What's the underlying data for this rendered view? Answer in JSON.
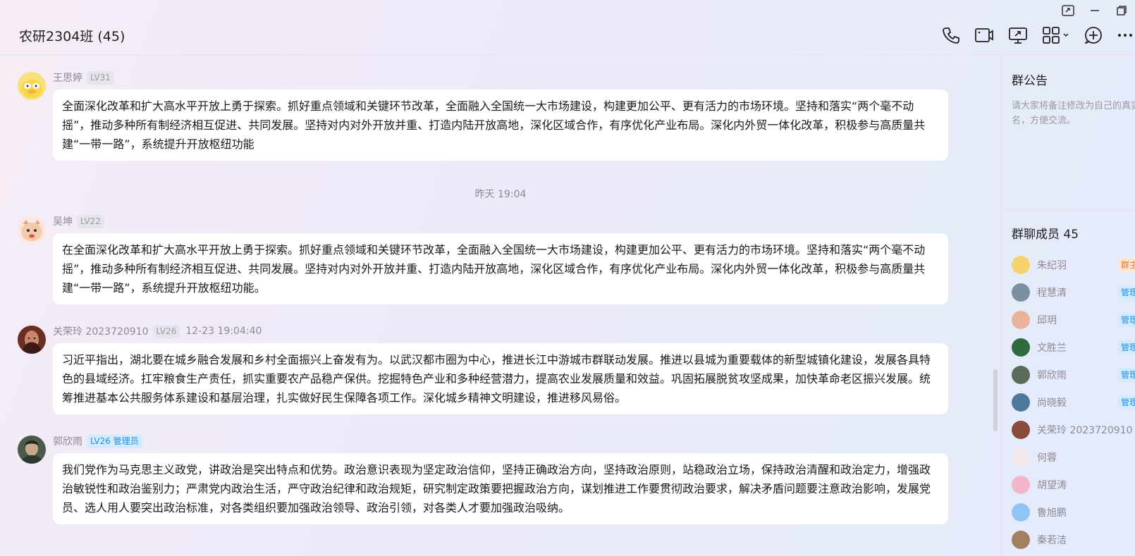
{
  "window": {
    "controls": [
      "pip-icon",
      "minimize-icon",
      "maximize-icon"
    ]
  },
  "header": {
    "title": "农研2304班 (45)",
    "icons": [
      "phone-icon",
      "video-icon",
      "screen-share-icon",
      "apps-icon",
      "add-icon",
      "more-icon"
    ]
  },
  "messages": [
    {
      "sender": "王思婷",
      "level": "LV31",
      "role": "",
      "text": "全面深化改革和扩大高水平开放上勇于探索。抓好重点领域和关键环节改革，全面融入全国统一大市场建设，构建更加公平、更有活力的市场环境。坚持和落实“两个毫不动摇”，推动多种所有制经济相互促进、共同发展。坚持对内对外开放并重、打造内陆开放高地，深化区域合作，有序优化产业布局。深化内外贸一体化改革，积极参与高质量共建“一带一路”，系统提升开放枢纽功能"
    },
    {
      "sender": "吴坤",
      "level": "LV22",
      "role": "",
      "text": "在全面深化改革和扩大高水平开放上勇于探索。抓好重点领域和关键环节改革，全面融入全国统一大市场建设，构建更加公平、更有活力的市场环境。坚持和落实“两个毫不动摇”，推动多种所有制经济相互促进、共同发展。坚持对内对外开放并重、打造内陆开放高地，深化区域合作，有序优化产业布局。深化内外贸一体化改革，积极参与高质量共建“一带一路”，系统提升开放枢纽功能。"
    },
    {
      "sender": "关荣玲 2023720910",
      "level": "LV26",
      "role": "",
      "time": "12-23 19:04:40",
      "text": "习近平指出，湖北要在城乡融合发展和乡村全面振兴上奋发有为。以武汉都市圈为中心，推进长江中游城市群联动发展。推进以县城为重要载体的新型城镇化建设，发展各具特色的县域经济。扛牢粮食生产责任，抓实重要农产品稳产保供。挖掘特色产业和多种经营潜力，提高农业发展质量和效益。巩固拓展脱贫攻坚成果，加快革命老区振兴发展。统筹推进基本公共服务体系建设和基层治理，扎实做好民生保障各项工作。深化城乡精神文明建设，推进移风易俗。"
    },
    {
      "sender": "郭欣雨",
      "level": "LV26 管理员",
      "role": "admin",
      "text": "我们党作为马克思主义政党，讲政治是突出特点和优势。政治意识表现为坚定政治信仰，坚持正确政治方向，坚持政治原则，站稳政治立场，保持政治清醒和政治定力，增强政治敏锐性和政治鉴别力；严肃党内政治生活，严守政治纪律和政治规矩，研究制定政策要把握政治方向，谋划推进工作要贯彻政治要求，解决矛盾问题要注意政治影响，发展党员、选人用人要突出政治标准，对各类组织要加强政治领导、政治引领，对各类人才要加强政治吸纳。"
    }
  ],
  "divider_time": "昨天 19:04",
  "side": {
    "notice_title": "群公告",
    "notice_text": "请大家将备注修改为自己的真实姓名，方便交流。",
    "members_title": "群聊成员 45",
    "members": [
      {
        "name": "朱纪羽",
        "tag": "群主",
        "tag_type": "owner",
        "color": "#f5d36b"
      },
      {
        "name": "程慧清",
        "tag": "管理员",
        "tag_type": "adm",
        "color": "#7d8fa3"
      },
      {
        "name": "邱玥",
        "tag": "管理员",
        "tag_type": "adm",
        "color": "#e8b39a"
      },
      {
        "name": "文胜兰",
        "tag": "管理员",
        "tag_type": "adm",
        "color": "#2e6b3e"
      },
      {
        "name": "郭欣雨",
        "tag": "管理员",
        "tag_type": "adm",
        "color": "#5a6b5c"
      },
      {
        "name": "尚晓毅",
        "tag": "管理员",
        "tag_type": "adm",
        "color": "#4e7a9a"
      },
      {
        "name": "关荣玲 2023720910",
        "tag": "",
        "tag_type": "",
        "color": "#8a4a3a"
      },
      {
        "name": "何蓉",
        "tag": "",
        "tag_type": "",
        "color": "#f3e8ea"
      },
      {
        "name": "胡望涛",
        "tag": "",
        "tag_type": "",
        "color": "#f2b6c8"
      },
      {
        "name": "鲁旭鹏",
        "tag": "",
        "tag_type": "",
        "color": "#8fc4f5"
      },
      {
        "name": "秦若洁",
        "tag": "",
        "tag_type": "",
        "color": "#a08060"
      }
    ]
  }
}
